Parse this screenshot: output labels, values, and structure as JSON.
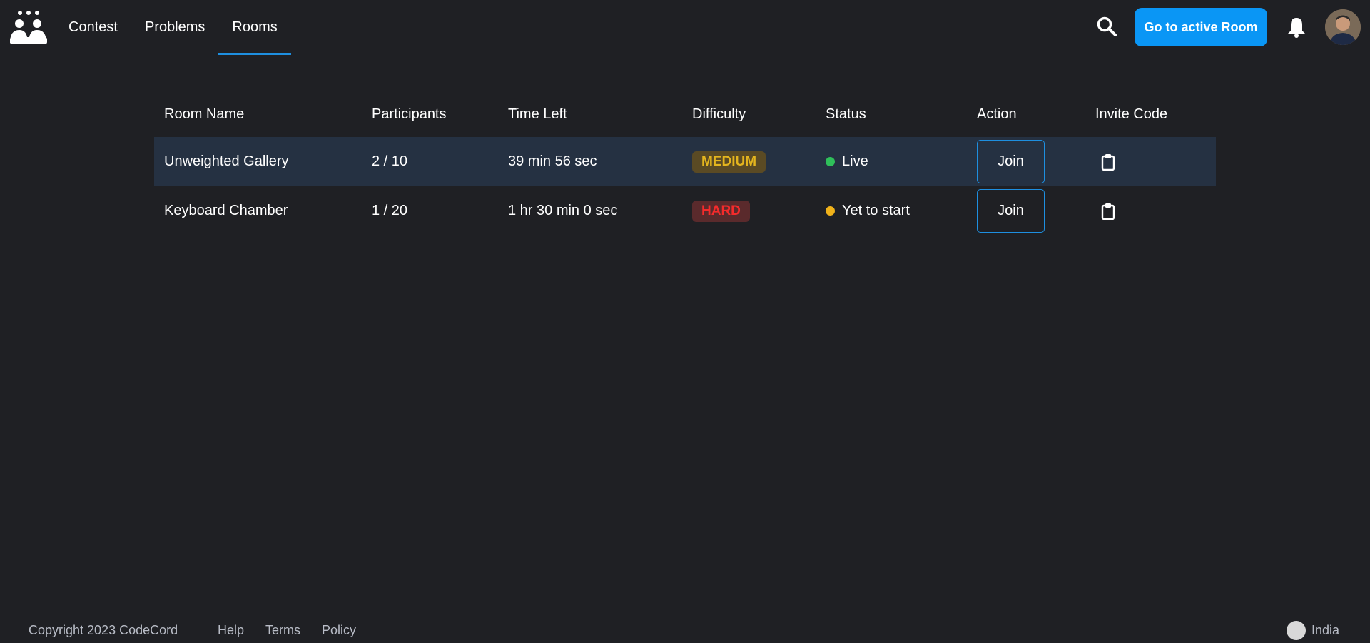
{
  "nav": {
    "items": [
      {
        "label": "Contest",
        "active": false
      },
      {
        "label": "Problems",
        "active": false
      },
      {
        "label": "Rooms",
        "active": true
      }
    ],
    "active_room_button": "Go to active Room",
    "accent_color": "#0a96f5"
  },
  "table": {
    "headers": [
      "Room Name",
      "Participants",
      "Time Left",
      "Difficulty",
      "Status",
      "Action",
      "Invite Code"
    ],
    "rows": [
      {
        "name": "Unweighted Gallery",
        "participants": "2 / 10",
        "time_left": "39 min 56 sec",
        "difficulty": "MEDIUM",
        "difficulty_color": "#e4b51e",
        "difficulty_bg": "#5a4a24",
        "status": "Live",
        "status_color": "#2fbf5a",
        "action": "Join",
        "invite_icon": "clipboard-icon"
      },
      {
        "name": "Keyboard Chamber",
        "participants": "1 / 20",
        "time_left": "1 hr 30 min 0 sec",
        "difficulty": "HARD",
        "difficulty_color": "#f42b2b",
        "difficulty_bg": "#5a2a2c",
        "status": "Yet to start",
        "status_color": "#f0b21a",
        "action": "Join",
        "invite_icon": "clipboard-icon"
      }
    ]
  },
  "footer": {
    "copyright": "Copyright 2023 CodeCord",
    "links": [
      "Help",
      "Terms",
      "Policy"
    ],
    "region": "India"
  }
}
